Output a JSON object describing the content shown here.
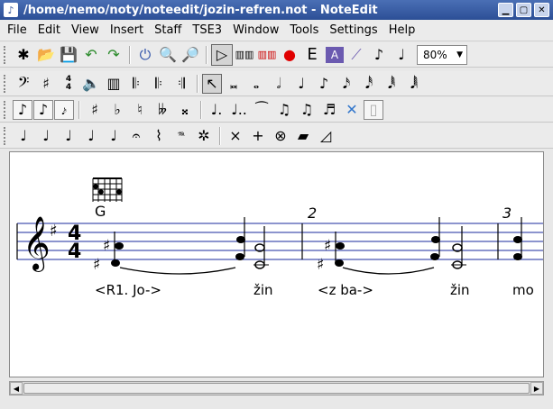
{
  "window": {
    "title": "/home/nemo/noty/noteedit/jozin-refren.not - NoteEdit"
  },
  "menu": [
    "File",
    "Edit",
    "View",
    "Insert",
    "Staff",
    "TSE3",
    "Window",
    "Tools",
    "Settings",
    "Help"
  ],
  "toolbar": {
    "zoom_value": "80%"
  },
  "score": {
    "chord_name": "G",
    "measure_numbers": [
      "2",
      "3"
    ],
    "lyrics": [
      "<R1. Jo->",
      "žin",
      "<z ba->",
      "žin",
      "mo"
    ],
    "time_signature": {
      "top": "4",
      "bottom": "4"
    }
  },
  "colors": {
    "staff_lines": "#1a2a9c",
    "title_bg": "#2c4f96",
    "record": "#e00000"
  }
}
